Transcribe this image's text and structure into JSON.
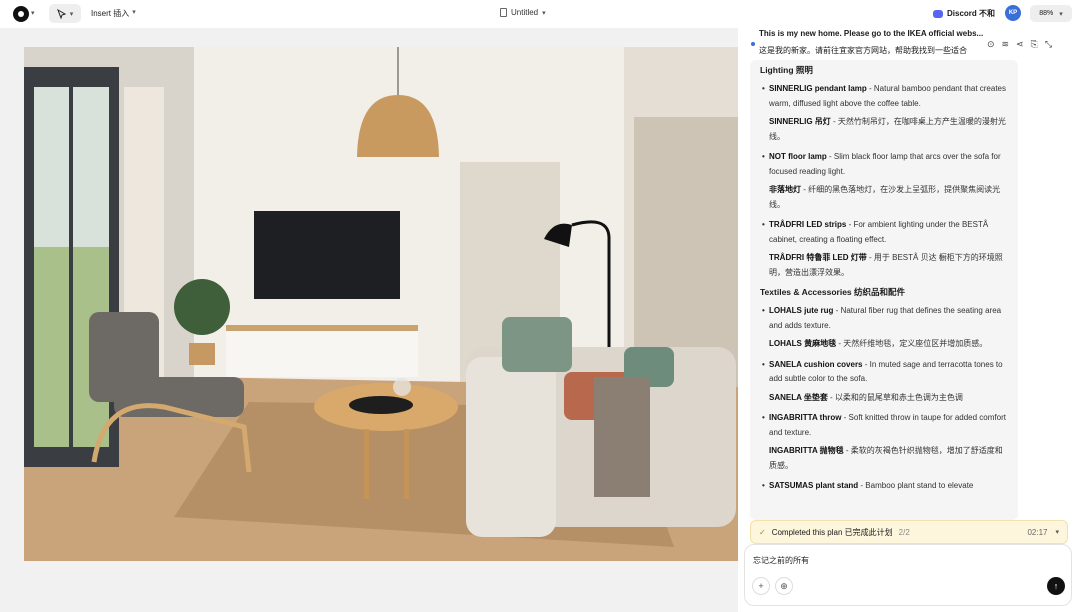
{
  "toolbar": {
    "insert_label": "Insert 插入",
    "doc_title": "Untitled",
    "discord_label": "Discord 不和",
    "avatar_initials": "KP",
    "zoom": "88%"
  },
  "chat": {
    "prompt_en": "This is my new home. Please go to the IKEA official webs...",
    "prompt_zh": "这是我的新家。请前往宜家官方网站，帮助我找到一些适合",
    "sections": [
      {
        "title": "Lighting 照明",
        "items": [
          {
            "name": "SINNERLIG pendant lamp",
            "desc": " - Natural bamboo pendant that creates warm, diffused light above the coffee table.",
            "name_zh": "SINNERLIG 吊灯",
            "desc_zh": " - 天然竹制吊灯，在咖啡桌上方产生温暖的漫射光线。"
          },
          {
            "name": "NOT floor lamp",
            "desc": " - Slim black floor lamp that arcs over the sofa for focused reading light.",
            "name_zh": "非落地灯",
            "desc_zh": " - 纤细的黑色落地灯，在沙发上呈弧形，提供聚焦阅读光线。"
          },
          {
            "name": "TRÅDFRI LED strips",
            "desc": " - For ambient lighting under the BESTÅ cabinet, creating a floating effect.",
            "name_zh": "TRÅDFRI 特鲁菲 LED 灯带",
            "desc_zh": " - 用于 BESTÅ 贝达 橱柜下方的环境照明，营造出漂浮效果。"
          }
        ]
      },
      {
        "title": "Textiles & Accessories 纺织品和配件",
        "items": [
          {
            "name": "LOHALS jute rug",
            "desc": " - Natural fiber rug that defines the seating area and adds texture.",
            "name_zh": "LOHALS 黄麻地毯",
            "desc_zh": " - 天然纤维地毯，定义座位区并增加质感。"
          },
          {
            "name": "SANELA cushion covers",
            "desc": " - In muted sage and terracotta tones to add subtle color to the sofa.",
            "name_zh": "SANELA 坐垫套",
            "desc_zh": " - 以柔和的鼠尾草和赤土色调为主色调"
          },
          {
            "name": "INGABRITTA throw",
            "desc": " - Soft knitted throw in taupe for added comfort and texture.",
            "name_zh": "INGABRITTA 抛物毯",
            "desc_zh": " - 柔软的灰褐色针织抛物毯，增加了舒适度和质感。"
          },
          {
            "name": "SATSUMAS plant stand",
            "desc": " - Bamboo plant stand to elevate",
            "name_zh": "",
            "desc_zh": ""
          }
        ]
      }
    ],
    "plan_status": "Completed this plan 已完成此计划",
    "plan_count": "2/2",
    "plan_time": "02:17",
    "input_value": "忘记之前的所有"
  },
  "icons": {
    "logo": "app-logo-icon",
    "pointer": "pointer-icon",
    "layers": "layers-icon",
    "send": "arrow-up-icon",
    "add": "plus-icon",
    "web": "globe-icon"
  }
}
